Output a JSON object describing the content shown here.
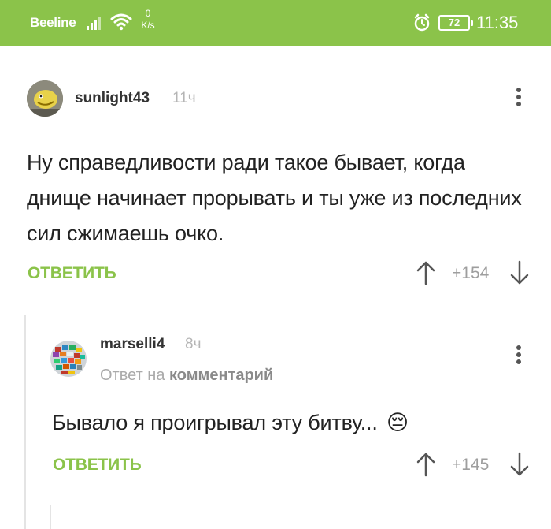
{
  "status_bar": {
    "carrier": "Beeline",
    "speed_value": "0",
    "speed_unit": "K/s",
    "battery": "72",
    "time": "11:35"
  },
  "comments": [
    {
      "username": "sunlight43",
      "time": "11ч",
      "text": "Ну справедливости ради такое бывает, когда днище начинает прорывать и ты уже из последних сил сжимаешь очко.",
      "reply_label": "ОТВЕТИТЬ",
      "score": "+154"
    },
    {
      "username": "marselli4",
      "time": "8ч",
      "reply_prefix": "Ответ на",
      "reply_target": "комментарий",
      "text": "Бывало я проигрывал эту битву...",
      "emoji": "😔",
      "reply_label": "ОТВЕТИТЬ",
      "score": "+145"
    }
  ],
  "colors": {
    "accent": "#8bc34a",
    "muted": "#9e9e9e"
  }
}
